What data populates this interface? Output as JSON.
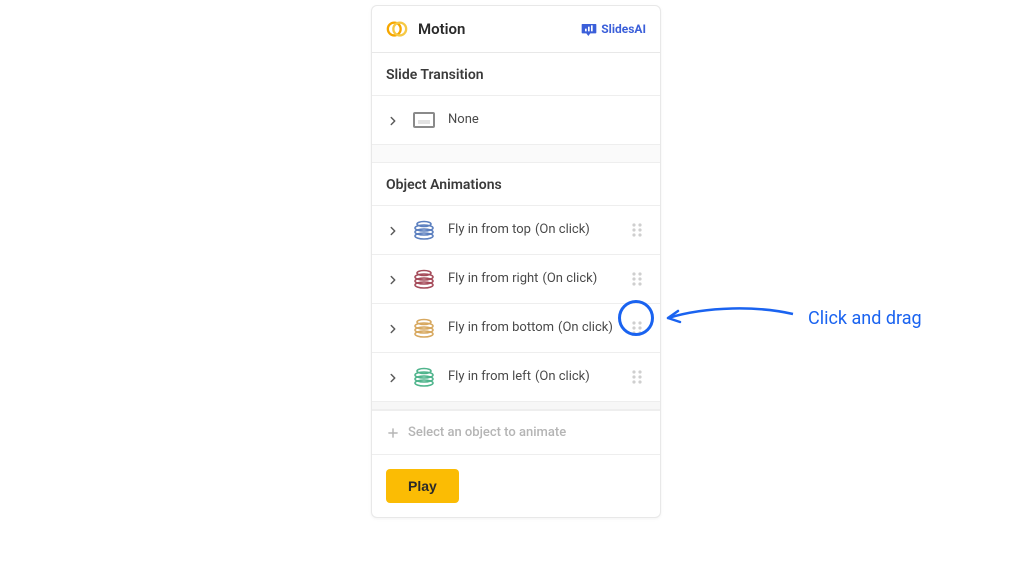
{
  "header": {
    "title": "Motion",
    "brand": "SlidesAI"
  },
  "sections": {
    "transition_label": "Slide Transition",
    "animations_label": "Object Animations"
  },
  "transition": {
    "name": "None"
  },
  "animations": [
    {
      "name": "Fly in from top",
      "trigger": "(On click)",
      "color": "#5b7fbf"
    },
    {
      "name": "Fly in from right",
      "trigger": "(On click)",
      "color": "#a54b5a"
    },
    {
      "name": "Fly in from bottom",
      "trigger": "(On click)",
      "color": "#d7a85f"
    },
    {
      "name": "Fly in from left",
      "trigger": "(On click)",
      "color": "#4fb48c"
    }
  ],
  "prompts": {
    "select_object": "Select an object to animate"
  },
  "buttons": {
    "play": "Play"
  },
  "annotation": {
    "text": "Click and drag"
  }
}
